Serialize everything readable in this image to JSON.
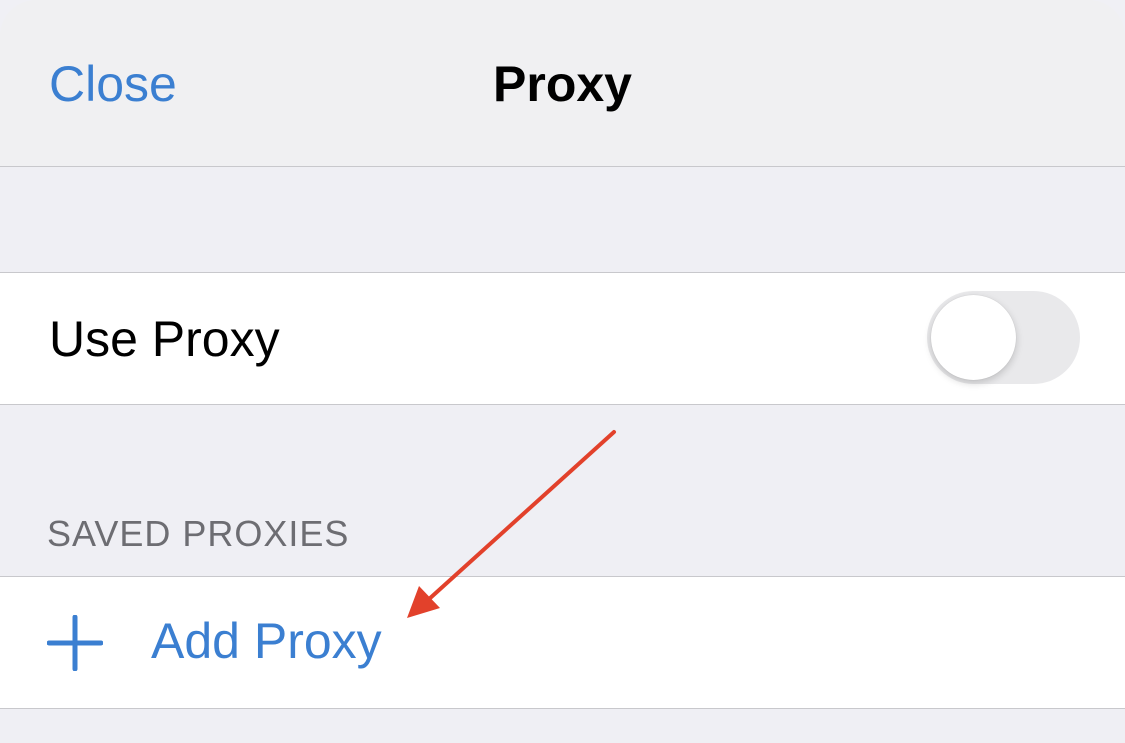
{
  "nav": {
    "close_label": "Close",
    "title": "Proxy"
  },
  "settings": {
    "use_proxy_label": "Use Proxy",
    "use_proxy_enabled": false
  },
  "saved_proxies": {
    "header": "SAVED PROXIES",
    "add_label": "Add Proxy"
  },
  "colors": {
    "accent": "#3b7fd1",
    "annotation_arrow": "#e2412b"
  },
  "icons": {
    "add": "plus-icon",
    "annotation": "arrow-annotation"
  }
}
